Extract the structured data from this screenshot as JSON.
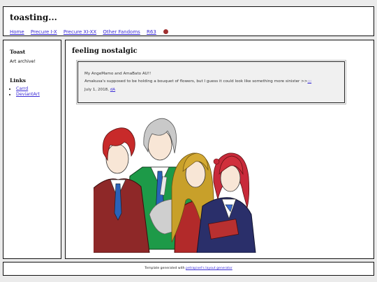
{
  "header": {
    "title": "toasting...",
    "nav": [
      "Home",
      "Precure I-X",
      "Precure XI-XX",
      "Other Fandoms",
      "R63"
    ],
    "nav_icon": "cherry-icon"
  },
  "sidebar": {
    "toast_title": "Toast",
    "toast_desc": "Art archive!",
    "links_title": "Links",
    "links": [
      "Carrd",
      "DeviantArt"
    ]
  },
  "post": {
    "title": "feeling nostalgic",
    "line1": "My AngeMamo and AmaBato AU!!",
    "line2_text": "Amakusa's supposed to be holding a bouquet of flowers, but I guess it could look like something more sinister >>",
    "line2_link": ";;;",
    "date": "July 1, 2018,",
    "date_link": "dA",
    "image": "anime-group-illustration"
  },
  "footer": {
    "text": "Template generated with ",
    "link": "petrapixel's layout generator"
  },
  "colors": {
    "link": "#3a2bd6",
    "border": "#111111",
    "page_bg": "#ebebeb"
  }
}
